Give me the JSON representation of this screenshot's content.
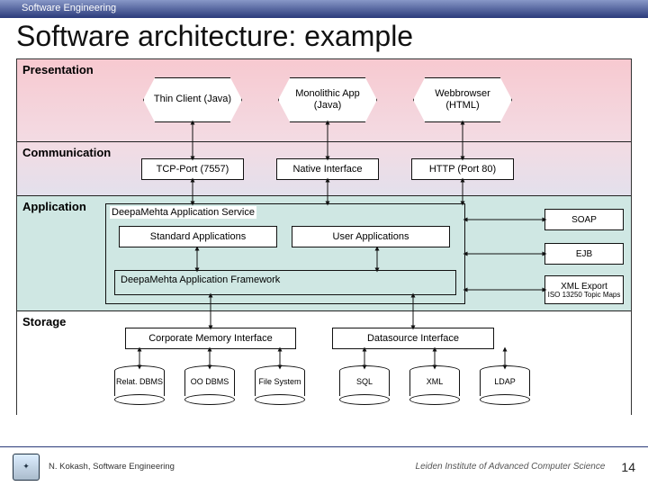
{
  "header": {
    "course": "Software Engineering"
  },
  "title": "Software architecture: example",
  "layers": {
    "presentation": "Presentation",
    "communication": "Communication",
    "application": "Application",
    "storage": "Storage"
  },
  "presentation_nodes": {
    "thin_client": "Thin Client\n(Java)",
    "monolithic": "Monolithic App\n(Java)",
    "browser": "Webbrowser\n(HTML)"
  },
  "communication_nodes": {
    "tcp": "TCP-Port (7557)",
    "native": "Native Interface",
    "http": "HTTP (Port 80)"
  },
  "application": {
    "service_label": "DeepaMehta Application Service",
    "std_apps": "Standard Applications",
    "user_apps": "User Applications",
    "framework": "DeepaMehta Application Framework"
  },
  "right_exports": {
    "soap": "SOAP",
    "ejb": "EJB",
    "xml_export": "XML Export",
    "xml_sub": "ISO 13250 Topic Maps"
  },
  "storage_interfaces": {
    "corporate": "Corporate Memory Interface",
    "datasource": "Datasource Interface"
  },
  "storage_cylinders": {
    "relat": "Relat.\nDBMS",
    "oo": "OO\nDBMS",
    "file": "File\nSystem",
    "sql": "SQL",
    "xml": "XML",
    "ldap": "LDAP"
  },
  "footer": {
    "author": "N. Kokash, Software Engineering",
    "institute": "Leiden Institute of Advanced Computer Science",
    "page": "14"
  }
}
